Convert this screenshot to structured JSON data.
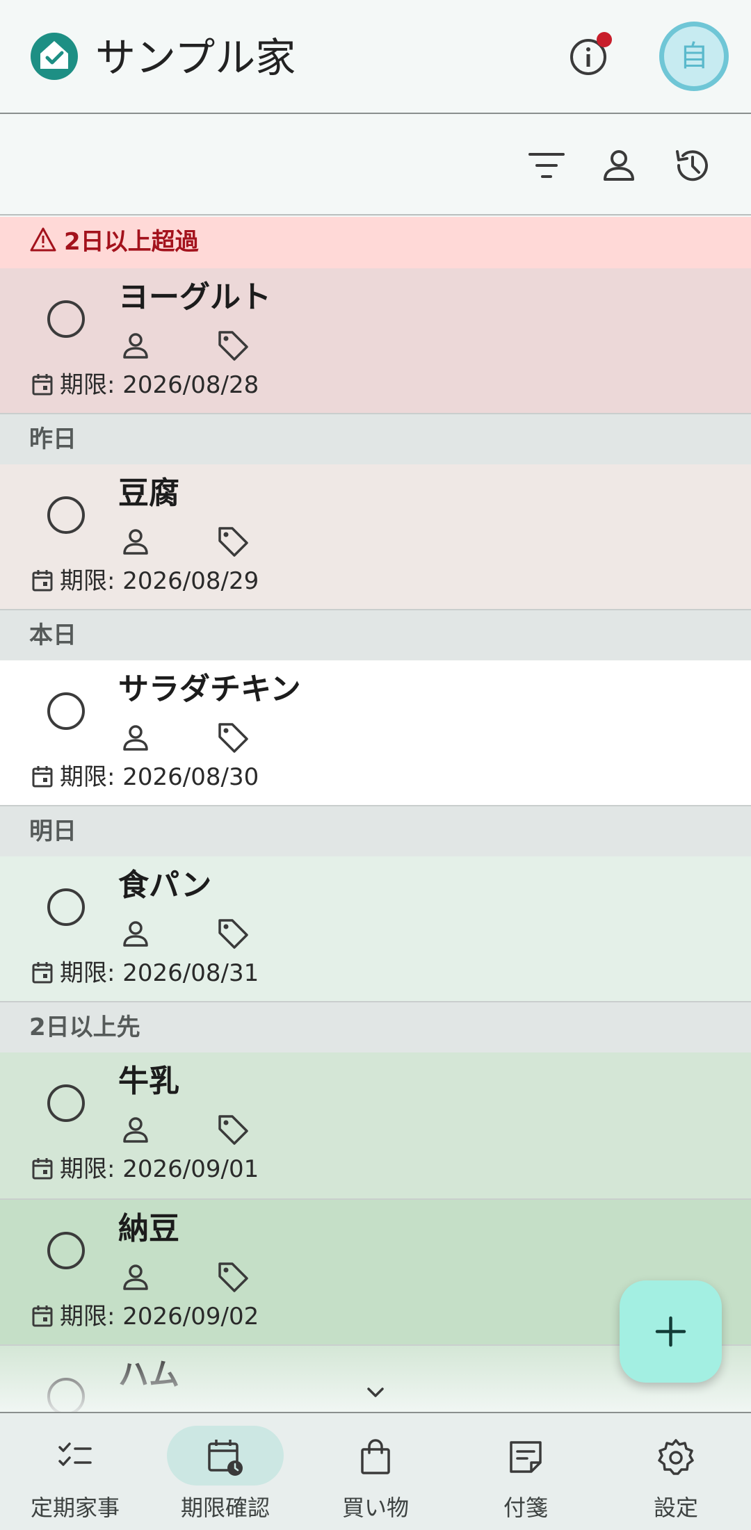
{
  "app": {
    "title": "サンプル家",
    "avatar_label": "自"
  },
  "colors": {
    "accent": "#1d8f84",
    "overdue_text": "#a3121c",
    "fab": "#a3efe2",
    "notification_dot": "#c81e2b"
  },
  "sections": [
    {
      "title": "2日以上超過",
      "items": [
        {
          "name": "ヨーグルト",
          "due": "期限: 2026/08/28"
        }
      ]
    },
    {
      "title": "昨日",
      "items": [
        {
          "name": "豆腐",
          "due": "期限: 2026/08/29"
        }
      ]
    },
    {
      "title": "本日",
      "items": [
        {
          "name": "サラダチキン",
          "due": "期限: 2026/08/30"
        }
      ]
    },
    {
      "title": "明日",
      "items": [
        {
          "name": "食パン",
          "due": "期限: 2026/08/31"
        }
      ]
    },
    {
      "title": "2日以上先",
      "items": [
        {
          "name": "牛乳",
          "due": "期限: 2026/09/01"
        },
        {
          "name": "納豆",
          "due": "期限: 2026/09/02"
        },
        {
          "name": "ハム"
        }
      ]
    }
  ],
  "nav": [
    {
      "label": "定期家事",
      "icon": "checklist-icon"
    },
    {
      "label": "期限確認",
      "icon": "calendar-clock-icon",
      "active": true
    },
    {
      "label": "買い物",
      "icon": "shopping-bag-icon"
    },
    {
      "label": "付箋",
      "icon": "sticky-note-icon"
    },
    {
      "label": "設定",
      "icon": "gear-icon"
    }
  ]
}
